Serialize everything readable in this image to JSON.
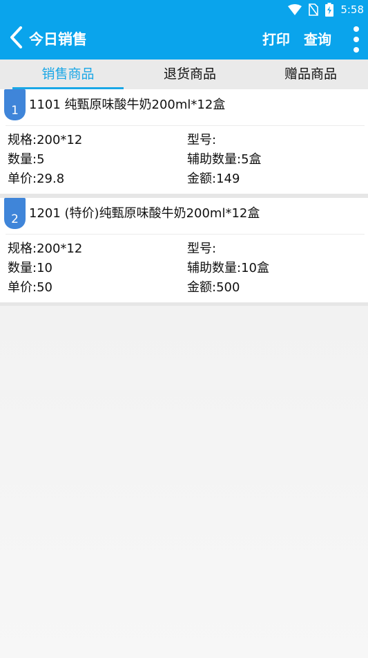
{
  "status_bar": {
    "time": "5:58",
    "icons": [
      "wifi-icon",
      "no-sim-icon",
      "battery-charging-icon"
    ]
  },
  "app_bar": {
    "title": "今日销售",
    "actions": {
      "print": "打印",
      "query": "查询"
    },
    "icons": [
      "back-arrow-icon",
      "more-vert-icon"
    ]
  },
  "tabs": [
    {
      "label": "销售商品",
      "selected": true
    },
    {
      "label": "退货商品",
      "selected": false
    },
    {
      "label": "赠品商品",
      "selected": false
    }
  ],
  "accent_color": "#0aa4ec",
  "items": [
    {
      "index": "1",
      "title": "1101 纯甄原味酸牛奶200ml*12盒",
      "spec": "规格:200*12",
      "model": "型号:",
      "quantity": "数量:5",
      "aux_quantity": "辅助数量:5盒",
      "unit_price": "单价:29.8",
      "amount": "金额:149"
    },
    {
      "index": "2",
      "title": "1201 (特价)纯甄原味酸牛奶200ml*12盒",
      "spec": "规格:200*12",
      "model": "型号:",
      "quantity": "数量:10",
      "aux_quantity": "辅助数量:10盒",
      "unit_price": "单价:50",
      "amount": "金额:500"
    }
  ]
}
